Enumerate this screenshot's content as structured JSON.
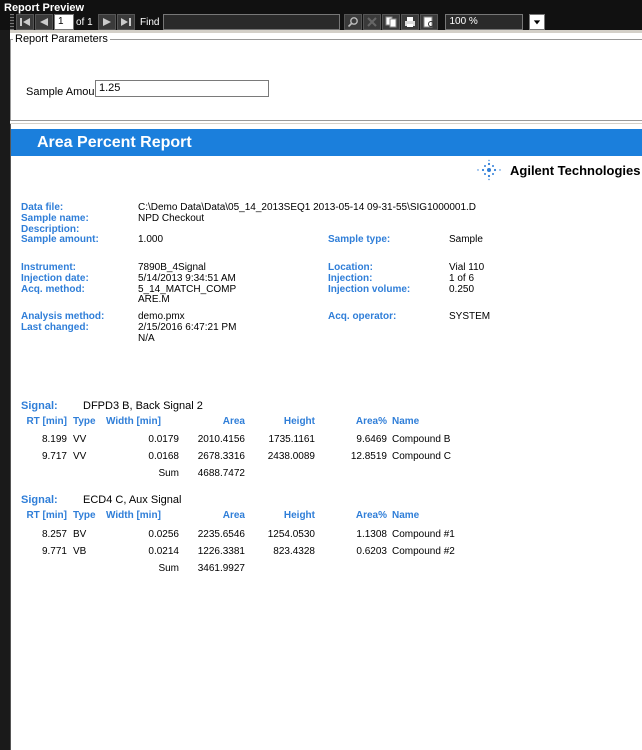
{
  "window": {
    "title": "Report Preview"
  },
  "toolbar": {
    "page_current": "1",
    "page_of": "of 1",
    "find_label": "Find",
    "zoom": "100 %",
    "icons": [
      "first-page-icon",
      "prev-page-icon",
      "next-page-icon",
      "last-page-icon",
      "search-icon",
      "clear-icon",
      "copy-icon",
      "print-icon",
      "export-icon"
    ]
  },
  "params": {
    "legend": "Report Parameters",
    "sample_amount_label": "Sample Amount",
    "sample_amount_value": "1.25"
  },
  "report": {
    "title": "Area Percent Report",
    "brand": "Agilent Technologies",
    "info": {
      "data_file_label": "Data file:",
      "data_file_value": "C:\\Demo Data\\Data\\05_14_2013SEQ1 2013-05-14 09-31-55\\SIG1000001.D",
      "sample_name_label": "Sample name:",
      "sample_name_value": "NPD Checkout",
      "description_label": "Description:",
      "sample_amount_label": "Sample amount:",
      "sample_amount_value": "1.000",
      "sample_type_label": "Sample type:",
      "sample_type_value": "Sample",
      "instrument_label": "Instrument:",
      "instrument_value": "7890B_4Signal",
      "location_label": "Location:",
      "location_value": "Vial 110",
      "injection_date_label": "Injection date:",
      "injection_date_value": "5/14/2013 9:34:51 AM",
      "injection_label": "Injection:",
      "injection_value": "1 of 6",
      "acq_method_label": "Acq. method:",
      "acq_method_value_1": "5_14_MATCH_COMP",
      "acq_method_value_2": "ARE.M",
      "injection_volume_label": "Injection volume:",
      "injection_volume_value": "0.250",
      "analysis_method_label": "Analysis method:",
      "analysis_method_value": "demo.pmx",
      "acq_operator_label": "Acq. operator:",
      "acq_operator_value": "SYSTEM",
      "last_changed_label": "Last changed:",
      "last_changed_value": "2/15/2016 6:47:21 PM",
      "last_changed_value_2": "N/A"
    },
    "columns": {
      "rt": "RT [min]",
      "type": "Type",
      "width": "Width [min]",
      "area": "Area",
      "height": "Height",
      "area_pct": "Area%",
      "name": "Name",
      "sum": "Sum"
    },
    "signals": [
      {
        "label": "Signal:",
        "name": "DFPD3 B, Back Signal 2",
        "rows": [
          {
            "rt": "8.199",
            "type": "VV",
            "width": "0.0179",
            "area": "2010.4156",
            "height": "1735.1161",
            "area_pct": "9.6469",
            "name": "Compound B"
          },
          {
            "rt": "9.717",
            "type": "VV",
            "width": "0.0168",
            "area": "2678.3316",
            "height": "2438.0089",
            "area_pct": "12.8519",
            "name": "Compound C"
          }
        ],
        "sum": "4688.7472"
      },
      {
        "label": "Signal:",
        "name": "ECD4 C, Aux Signal",
        "rows": [
          {
            "rt": "8.257",
            "type": "BV",
            "width": "0.0256",
            "area": "2235.6546",
            "height": "1254.0530",
            "area_pct": "1.1308",
            "name": "Compound #1"
          },
          {
            "rt": "9.771",
            "type": "VB",
            "width": "0.0214",
            "area": "1226.3381",
            "height": "823.4328",
            "area_pct": "0.6203",
            "name": "Compound #2"
          }
        ],
        "sum": "3461.9927"
      }
    ]
  },
  "colors": {
    "header_blue": "#1b7fdc",
    "label_blue": "#2f7ed8",
    "titlebar": "#111111"
  }
}
